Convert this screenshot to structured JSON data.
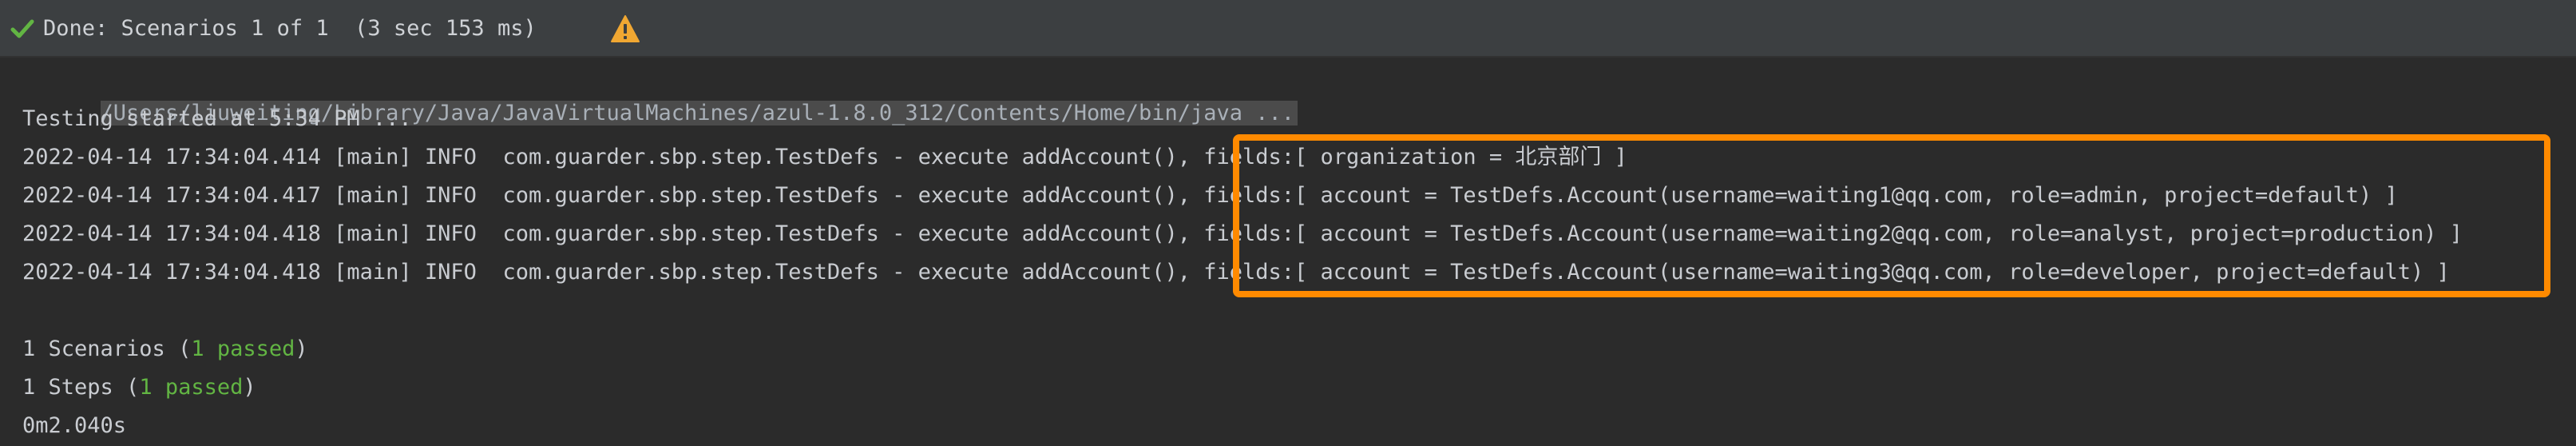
{
  "status": {
    "text": "Done: Scenarios 1 of 1  (3 sec 153 ms)",
    "icon_left": "check-icon",
    "icon_right": "warning-icon",
    "check_color": "#62b543",
    "warning_color": "#f0a732"
  },
  "console": {
    "command": "/Users/liuweiting/Library/Java/JavaVirtualMachines/azul-1.8.0_312/Contents/Home/bin/java ...",
    "testing_started": "Testing started at 5:34 PM ...",
    "log_lines": [
      "2022-04-14 17:34:04.414 [main] INFO  com.guarder.sbp.step.TestDefs - execute addAccount(), fields:[ organization = 北京部门 ]",
      "2022-04-14 17:34:04.417 [main] INFO  com.guarder.sbp.step.TestDefs - execute addAccount(), fields:[ account = TestDefs.Account(username=waiting1@qq.com, role=admin, project=default) ]",
      "2022-04-14 17:34:04.418 [main] INFO  com.guarder.sbp.step.TestDefs - execute addAccount(), fields:[ account = TestDefs.Account(username=waiting2@qq.com, role=analyst, project=production) ]",
      "2022-04-14 17:34:04.418 [main] INFO  com.guarder.sbp.step.TestDefs - execute addAccount(), fields:[ account = TestDefs.Account(username=waiting3@qq.com, role=developer, project=default) ]"
    ],
    "summary": {
      "scenarios_prefix": "1 Scenarios (",
      "scenarios_passed": "1 passed",
      "scenarios_suffix": ")",
      "steps_prefix": "1 Steps (",
      "steps_passed": "1 passed",
      "steps_suffix": ")",
      "duration": "0m2.040s"
    },
    "highlight_color": "#ff8a00",
    "passed_color": "#62b543"
  }
}
